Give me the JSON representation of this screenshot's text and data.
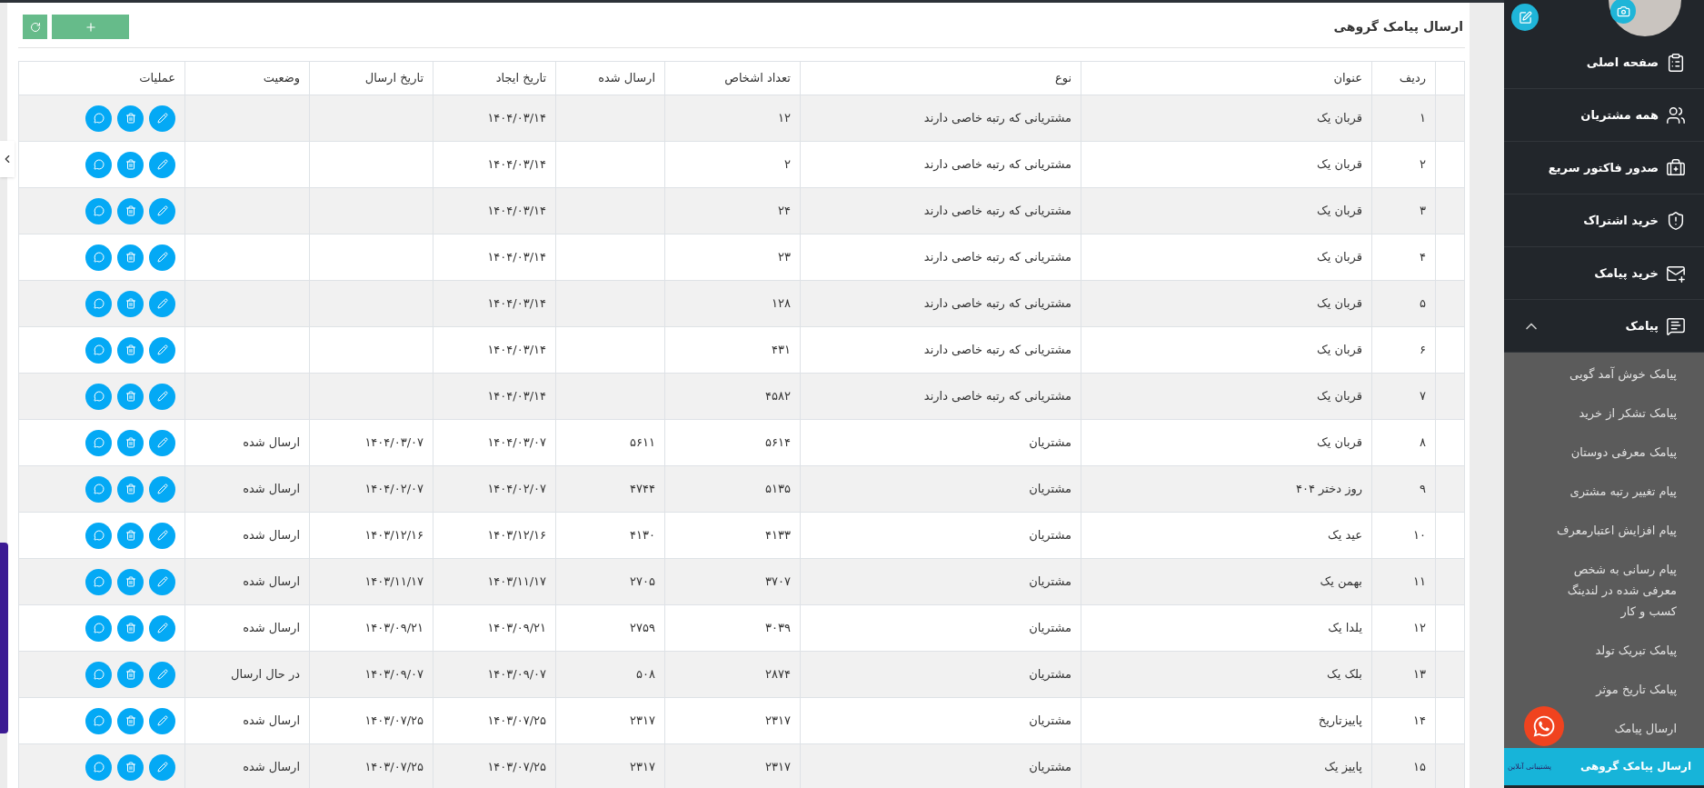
{
  "toolbar": {
    "buttons": [
      {
        "kind": "refresh"
      },
      {
        "kind": "add"
      }
    ]
  },
  "page_title": "ارسال پیامک گروهی",
  "table": {
    "columns": [
      "ردیف",
      "عنوان",
      "نوع",
      "تعداد اشخاص",
      "ارسال شده",
      "تاریخ ایجاد",
      "تاریخ ارسال",
      "وضعیت",
      "عملیات"
    ],
    "rows": [
      {
        "cells": [
          "۱",
          "قربان یک",
          "مشتریانی که رتبه خاصی دارند",
          "۱۲",
          "",
          "۱۴۰۴/۰۳/۱۴",
          "",
          ""
        ]
      },
      {
        "cells": [
          "۲",
          "قربان یک",
          "مشتریانی که رتبه خاصی دارند",
          "۲",
          "",
          "۱۴۰۴/۰۳/۱۴",
          "",
          ""
        ]
      },
      {
        "cells": [
          "۳",
          "قربان یک",
          "مشتریانی که رتبه خاصی دارند",
          "۲۴",
          "",
          "۱۴۰۴/۰۳/۱۴",
          "",
          ""
        ]
      },
      {
        "cells": [
          "۴",
          "قربان یک",
          "مشتریانی که رتبه خاصی دارند",
          "۲۳",
          "",
          "۱۴۰۴/۰۳/۱۴",
          "",
          ""
        ]
      },
      {
        "cells": [
          "۵",
          "قربان یک",
          "مشتریانی که رتبه خاصی دارند",
          "۱۲۸",
          "",
          "۱۴۰۴/۰۳/۱۴",
          "",
          ""
        ]
      },
      {
        "cells": [
          "۶",
          "قربان یک",
          "مشتریانی که رتبه خاصی دارند",
          "۴۳۱",
          "",
          "۱۴۰۴/۰۳/۱۴",
          "",
          ""
        ]
      },
      {
        "cells": [
          "۷",
          "قربان یک",
          "مشتریانی که رتبه خاصی دارند",
          "۴۵۸۲",
          "",
          "۱۴۰۴/۰۳/۱۴",
          "",
          ""
        ]
      },
      {
        "cells": [
          "۸",
          "قربان یک",
          "مشتریان",
          "۵۶۱۴",
          "۵۶۱۱",
          "۱۴۰۴/۰۳/۰۷",
          "۱۴۰۴/۰۳/۰۷",
          "ارسال شده"
        ]
      },
      {
        "cells": [
          "۹",
          "روز دختر ۴۰۴",
          "مشتریان",
          "۵۱۳۵",
          "۴۷۴۴",
          "۱۴۰۴/۰۲/۰۷",
          "۱۴۰۴/۰۲/۰۷",
          "ارسال شده"
        ]
      },
      {
        "cells": [
          "۱۰",
          "عید یک",
          "مشتریان",
          "۴۱۳۳",
          "۴۱۳۰",
          "۱۴۰۳/۱۲/۱۶",
          "۱۴۰۳/۱۲/۱۶",
          "ارسال شده"
        ]
      },
      {
        "cells": [
          "۱۱",
          "بهمن یک",
          "مشتریان",
          "۳۷۰۷",
          "۲۷۰۵",
          "۱۴۰۳/۱۱/۱۷",
          "۱۴۰۳/۱۱/۱۷",
          "ارسال شده"
        ]
      },
      {
        "cells": [
          "۱۲",
          "یلدا یک",
          "مشتریان",
          "۳۰۳۹",
          "۲۷۵۹",
          "۱۴۰۳/۰۹/۲۱",
          "۱۴۰۳/۰۹/۲۱",
          "ارسال شده"
        ]
      },
      {
        "cells": [
          "۱۳",
          "بلک یک",
          "مشتریان",
          "۲۸۷۴",
          "۵۰۸",
          "۱۴۰۳/۰۹/۰۷",
          "۱۴۰۳/۰۹/۰۷",
          "در حال ارسال"
        ]
      },
      {
        "cells": [
          "۱۴",
          "پاییزتاریخ",
          "مشتریان",
          "۲۳۱۷",
          "۲۳۱۷",
          "۱۴۰۳/۰۷/۲۵",
          "۱۴۰۳/۰۷/۲۵",
          "ارسال شده"
        ]
      },
      {
        "cells": [
          "۱۵",
          "پاییز یک",
          "مشتریان",
          "۲۳۱۷",
          "۲۳۱۷",
          "۱۴۰۳/۰۷/۲۵",
          "۱۴۰۳/۰۷/۲۵",
          "ارسال شده"
        ]
      }
    ]
  },
  "sidebar": {
    "menu": [
      {
        "label": "صفحه اصلی"
      },
      {
        "label": "همه مشتریان"
      },
      {
        "label": "صدور فاکتور سریع"
      },
      {
        "label": "خرید اشتراک"
      },
      {
        "label": "خرید پیامک"
      },
      {
        "label": "پیامک",
        "expanded": true,
        "children": [
          {
            "label": "پیامک خوش آمد گویی",
            "selected": false
          },
          {
            "label": "پیامک تشکر از خرید",
            "selected": false
          },
          {
            "label": "پیامک معرفی دوستان",
            "selected": false
          },
          {
            "label": "پیام تغییر رتبه مشتری",
            "selected": false
          },
          {
            "label": "پیام افزایش اعتبارمعرف",
            "selected": false
          },
          {
            "label": "پیام رسانی به شخص معرفی شده در لندینگ کسب و کار",
            "selected": false
          },
          {
            "label": "پیامک تبریک تولد",
            "selected": false
          },
          {
            "label": "پیامک تاریخ موثر",
            "selected": false
          },
          {
            "label": "ارسال پیامک",
            "selected": false
          },
          {
            "label": "ارسال پیامک گروهی",
            "selected": true
          }
        ]
      }
    ]
  },
  "support": {
    "label": "پشتیبانی آنلاین"
  }
}
